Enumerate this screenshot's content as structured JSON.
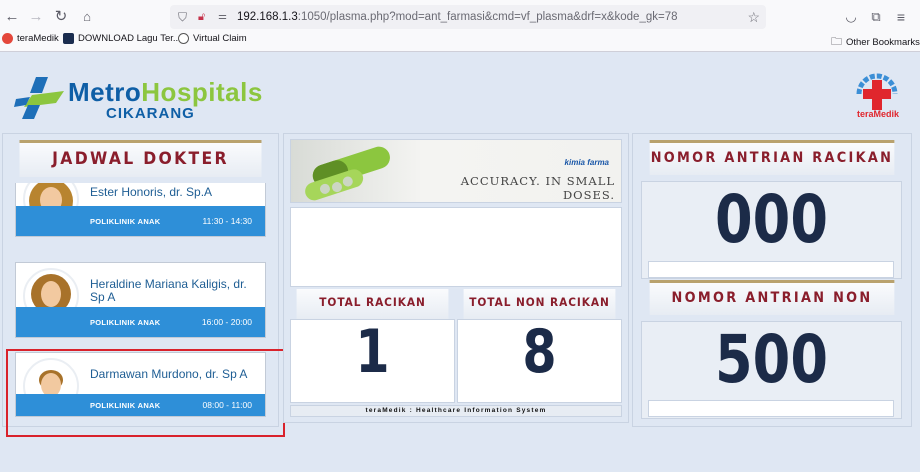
{
  "browser": {
    "url_host": "192.168.1.3",
    "url_rest": ":1050/plasma.php?mod=ant_farmasi&cmd=vf_plasma&drf=x&kode_gk=78",
    "bookmarks": [
      "teraMedik",
      "DOWNLOAD Lagu Ter...",
      "Virtual Claim"
    ],
    "other_bookmarks": "Other Bookmarks"
  },
  "header": {
    "logo_metro": "Metro",
    "logo_hospitals": "Hospitals",
    "logo_sub": "CIKARANG",
    "teramedik_logo": "teraMedik",
    "colors": {
      "metro": "#0f5fa6",
      "hospitals": "#8cc63f",
      "accent": "#8a1e2c"
    }
  },
  "jadwal": {
    "title": "JADWAL DOKTER",
    "doctors": [
      {
        "name": "Ester Honoris, dr. Sp.A",
        "poli": "POLIKLINIK ANAK",
        "time": "11:30 - 14:30",
        "gender": "female"
      },
      {
        "name": "Heraldine Mariana Kaligis, dr. Sp A",
        "poli": "POLIKLINIK ANAK",
        "time": "16:00 - 20:00",
        "gender": "female"
      },
      {
        "name": "Darmawan Murdono, dr. Sp A",
        "poli": "POLIKLINIK ANAK",
        "time": "08:00 - 11:00",
        "gender": "male"
      }
    ]
  },
  "banner": {
    "brand": "kimia farma",
    "tagline": "ACCURACY. IN SMALL DOSES."
  },
  "totals": {
    "racikan_label": "TOTAL RACIKAN",
    "racikan_value": "1",
    "non_racikan_label": "TOTAL NON RACIKAN",
    "non_racikan_value": "8",
    "footer": "teraMedik : Healthcare Information System"
  },
  "antrian": {
    "racikan_label": "NOMOR ANTRIAN RACIKAN",
    "racikan_value": "000",
    "non_racikan_label": "NOMOR ANTRIAN NON RACIKAN",
    "non_racikan_value": "500"
  }
}
